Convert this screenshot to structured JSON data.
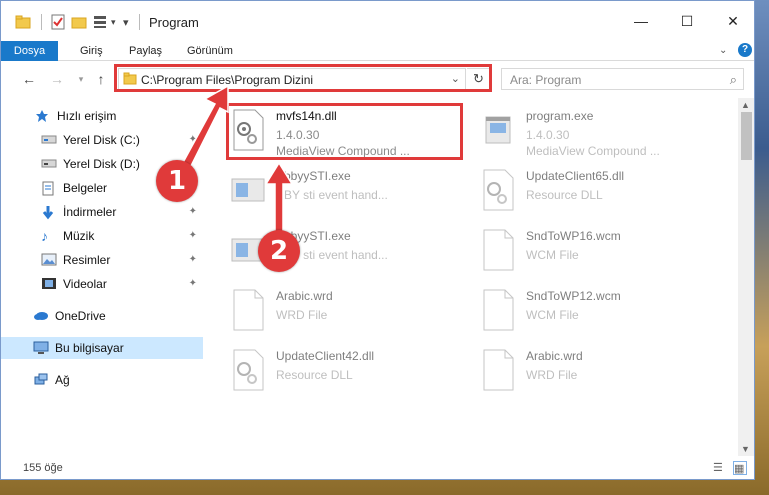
{
  "window": {
    "title": "Program"
  },
  "ribbon": {
    "tabs": [
      "Dosya",
      "Giriş",
      "Paylaş",
      "Görünüm"
    ]
  },
  "nav": {
    "address_path": "C:\\Program Files\\Program Dizini",
    "search_placeholder": "Ara: Program"
  },
  "sidebar": {
    "items": [
      {
        "label": "Hızlı erişim",
        "icon": "star-icon"
      },
      {
        "label": "Yerel Disk (C:)",
        "icon": "drive-icon"
      },
      {
        "label": "Yerel Disk (D:)",
        "icon": "drive-icon"
      },
      {
        "label": "Belgeler",
        "icon": "document-icon"
      },
      {
        "label": "İndirmeler",
        "icon": "download-icon"
      },
      {
        "label": "Müzik",
        "icon": "music-icon"
      },
      {
        "label": "Resimler",
        "icon": "pictures-icon"
      },
      {
        "label": "Videolar",
        "icon": "video-icon"
      },
      {
        "label": "OneDrive",
        "icon": "cloud-icon"
      },
      {
        "label": "Bu bilgisayar",
        "icon": "computer-icon"
      },
      {
        "label": "Ağ",
        "icon": "network-icon"
      }
    ]
  },
  "files": [
    {
      "name": "mvfs14n.dll",
      "line1": "1.4.0.30",
      "line2": "MediaView Compound ..."
    },
    {
      "name": "program.exe",
      "line1": "1.4.0.30",
      "line2": "MediaView Compound ..."
    },
    {
      "name": "AbbyySTI.exe",
      "line1": "",
      "line2": "BBY sti event hand..."
    },
    {
      "name": "UpdateClient65.dll",
      "line1": "Resource DLL",
      "line2": ""
    },
    {
      "name": "AbbyySTI.exe",
      "line1": "",
      "line2": "BBY sti event hand..."
    },
    {
      "name": "SndToWP16.wcm",
      "line1": "WCM File",
      "line2": ""
    },
    {
      "name": "Arabic.wrd",
      "line1": "WRD File",
      "line2": ""
    },
    {
      "name": "SndToWP12.wcm",
      "line1": "WCM File",
      "line2": ""
    },
    {
      "name": "UpdateClient42.dll",
      "line1": "Resource DLL",
      "line2": ""
    },
    {
      "name": "Arabic.wrd",
      "line1": "WRD File",
      "line2": ""
    }
  ],
  "status": {
    "item_count": "155 öğe"
  },
  "annotations": {
    "badge1": "1",
    "badge2": "2"
  },
  "colors": {
    "accent": "#1979ca",
    "annotation": "#e03a3a",
    "selected": "#cce8ff"
  }
}
